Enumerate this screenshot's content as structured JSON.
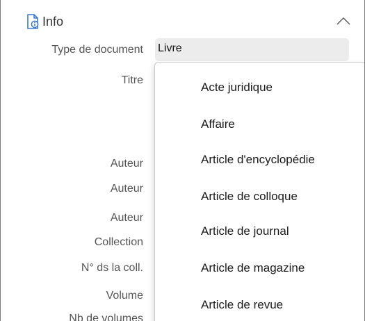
{
  "section": {
    "title": "Info",
    "icon": "document-info-icon",
    "collapse_icon": "chevron-up-icon"
  },
  "fields": {
    "document_type_label": "Type de document",
    "document_type_value": "Livre",
    "title_label": "Titre",
    "author_label_1": "Auteur",
    "author_label_2": "Auteur",
    "author_label_3": "Auteur",
    "collection_label": "Collection",
    "collection_number_label": "N° ds la coll.",
    "volume_label": "Volume",
    "volumes_count_label": "Nb de volumes"
  },
  "dropdown": {
    "items": [
      "Acte juridique",
      "Affaire",
      "Article d'encyclopédie",
      "Article de colloque",
      "Article de journal",
      "Article de magazine",
      "Article de revue"
    ]
  }
}
